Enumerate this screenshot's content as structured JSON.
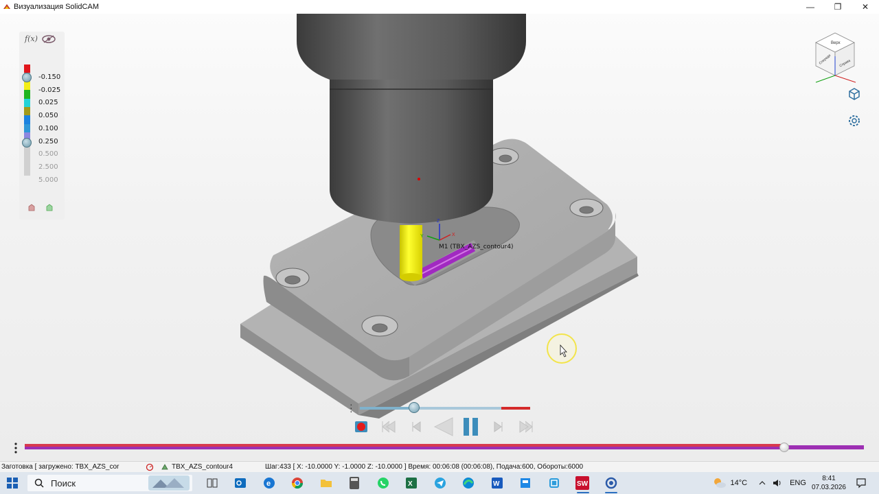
{
  "window": {
    "title": "Визуализация SolidCAM",
    "minimize_glyph": "—",
    "maximize_glyph": "❐",
    "close_glyph": "✕"
  },
  "legend": {
    "fx_label": "f(x)",
    "entries": [
      {
        "value": "-0.150",
        "color": "#1a1a1a"
      },
      {
        "value": "-0.025",
        "color": "#1a1a1a"
      },
      {
        "value": "0.025",
        "color": "#1a1a1a"
      },
      {
        "value": "0.050",
        "color": "#1a1a1a"
      },
      {
        "value": "0.100",
        "color": "#1a1a1a"
      },
      {
        "value": "0.250",
        "color": "#1a1a1a"
      },
      {
        "value": "0.500",
        "color": "#9a9a9a"
      },
      {
        "value": "2.500",
        "color": "#9a9a9a"
      },
      {
        "value": "5.000",
        "color": "#9a9a9a"
      }
    ],
    "swatches": [
      "#e1161c",
      "#9ea7ad",
      "#f3ee16",
      "#1fb51f",
      "#22d3d8",
      "#a39a19",
      "#1b82e0",
      "#2f97d8",
      "#8d88e0",
      "#d0d0d0",
      "#d0d0d0",
      "#d0d0d0",
      "#d0d0d0"
    ]
  },
  "scene": {
    "operation_label": "M1 (TBX_AZS_contour4)",
    "axis_x": "X",
    "axis_y": "Y",
    "axis_z": "Z",
    "cube_top": "Верх",
    "cube_front": "Спереди",
    "cube_right": "Справа"
  },
  "playback": {
    "sim_progress": 0.32,
    "main_progress": 0.905
  },
  "statusbar": {
    "stock": "Заготовка [ загружено:  TBX_AZS_cor",
    "operation": "TBX_AZS_contour4",
    "step": "Шаг:433 [ X: -10.0000 Y: -1.0000 Z: -10.0000 ] Время: 00:06:08 (00:06:08), Подача:600, Обороты:6000"
  },
  "taskbar": {
    "search_label": "Поиск",
    "weather": "14°C",
    "language": "ENG",
    "time": "8:41",
    "date": "07.03.2026"
  }
}
